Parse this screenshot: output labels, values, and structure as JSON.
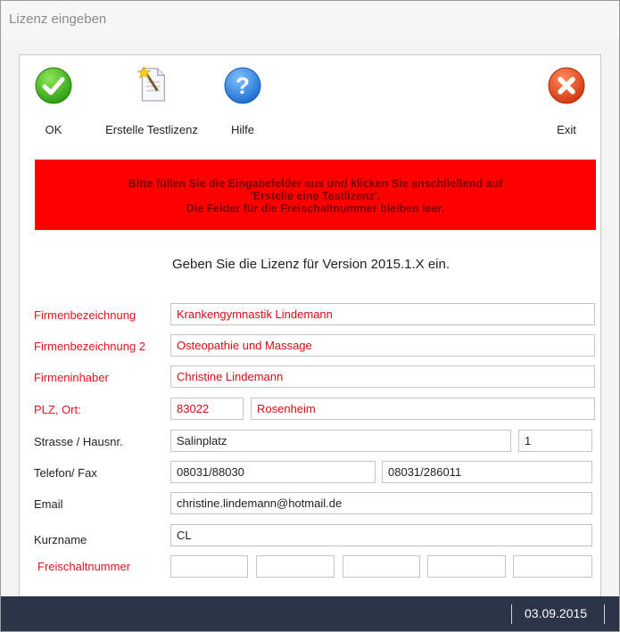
{
  "window": {
    "title": "Lizenz eingeben"
  },
  "toolbar": {
    "ok_label": "OK",
    "testlicense_label": "Erstelle Testlizenz",
    "help_label": "Hilfe",
    "exit_label": "Exit",
    "help_glyph": "?"
  },
  "banner": {
    "line1": "Bitte füllen Sie die Eingabefelder aus und klicken Sie anschließend auf",
    "line2": "'Erstelle eine Testlizenz'.",
    "line3": "Die Felder für die Freischaltnummer bleiben leer.",
    "bg_color": "#ff0000"
  },
  "heading": "Geben Sie die Lizenz für Version 2015.1.X ein.",
  "form": {
    "firma_label": "Firmenbezeichnung",
    "firma_value": "Krankengymnastik Lindemann",
    "firma2_label": "Firmenbezeichnung 2",
    "firma2_value": "Osteopathie und Massage",
    "inhaber_label": "Firmeninhaber",
    "inhaber_value": "Christine Lindemann",
    "plzort_label": "PLZ, Ort:",
    "plz_value": "83022",
    "ort_value": "Rosenheim",
    "strasse_label": "Strasse / Hausnr.",
    "strasse_value": "Salinplatz",
    "hausnr_value": "1",
    "telefon_label": "Telefon/ Fax",
    "telefon_value": "08031/88030",
    "fax_value": "08031/286011",
    "email_label": "Email",
    "email_value": "christine.lindemann@hotmail.de",
    "kurzname_label": "Kurzname",
    "kurzname_value": "CL",
    "freischalt_label": "Freischaltnummer",
    "freischalt_values": [
      "",
      "",
      "",
      "",
      ""
    ],
    "required_color": "#e0141e"
  },
  "statusbar": {
    "date": "03.09.2015",
    "bg_color": "#2b3547"
  },
  "icons": {
    "ok": "check-icon",
    "testlicense": "document-wand-icon",
    "help": "question-icon",
    "exit": "close-icon"
  }
}
